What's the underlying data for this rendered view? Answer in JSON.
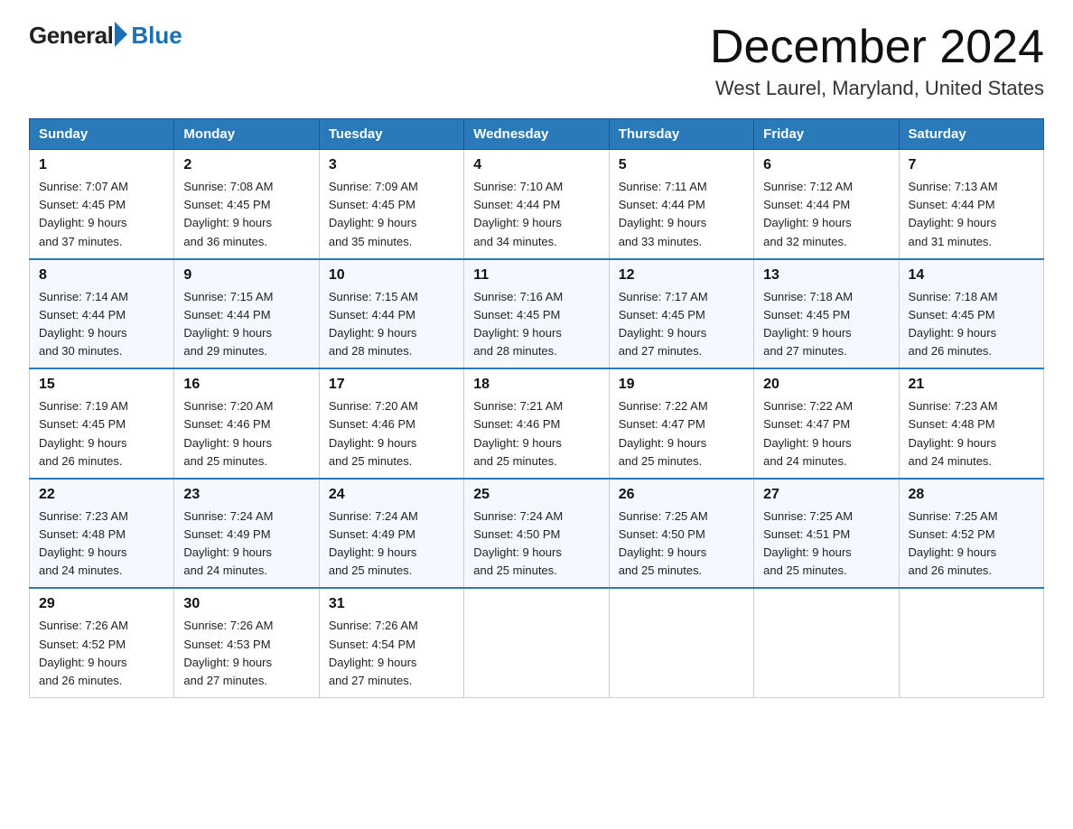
{
  "header": {
    "logo_general": "General",
    "logo_blue": "Blue",
    "month_title": "December 2024",
    "location": "West Laurel, Maryland, United States"
  },
  "days_of_week": [
    "Sunday",
    "Monday",
    "Tuesday",
    "Wednesday",
    "Thursday",
    "Friday",
    "Saturday"
  ],
  "weeks": [
    [
      {
        "day": "1",
        "sunrise": "7:07 AM",
        "sunset": "4:45 PM",
        "daylight": "9 hours and 37 minutes."
      },
      {
        "day": "2",
        "sunrise": "7:08 AM",
        "sunset": "4:45 PM",
        "daylight": "9 hours and 36 minutes."
      },
      {
        "day": "3",
        "sunrise": "7:09 AM",
        "sunset": "4:45 PM",
        "daylight": "9 hours and 35 minutes."
      },
      {
        "day": "4",
        "sunrise": "7:10 AM",
        "sunset": "4:44 PM",
        "daylight": "9 hours and 34 minutes."
      },
      {
        "day": "5",
        "sunrise": "7:11 AM",
        "sunset": "4:44 PM",
        "daylight": "9 hours and 33 minutes."
      },
      {
        "day": "6",
        "sunrise": "7:12 AM",
        "sunset": "4:44 PM",
        "daylight": "9 hours and 32 minutes."
      },
      {
        "day": "7",
        "sunrise": "7:13 AM",
        "sunset": "4:44 PM",
        "daylight": "9 hours and 31 minutes."
      }
    ],
    [
      {
        "day": "8",
        "sunrise": "7:14 AM",
        "sunset": "4:44 PM",
        "daylight": "9 hours and 30 minutes."
      },
      {
        "day": "9",
        "sunrise": "7:15 AM",
        "sunset": "4:44 PM",
        "daylight": "9 hours and 29 minutes."
      },
      {
        "day": "10",
        "sunrise": "7:15 AM",
        "sunset": "4:44 PM",
        "daylight": "9 hours and 28 minutes."
      },
      {
        "day": "11",
        "sunrise": "7:16 AM",
        "sunset": "4:45 PM",
        "daylight": "9 hours and 28 minutes."
      },
      {
        "day": "12",
        "sunrise": "7:17 AM",
        "sunset": "4:45 PM",
        "daylight": "9 hours and 27 minutes."
      },
      {
        "day": "13",
        "sunrise": "7:18 AM",
        "sunset": "4:45 PM",
        "daylight": "9 hours and 27 minutes."
      },
      {
        "day": "14",
        "sunrise": "7:18 AM",
        "sunset": "4:45 PM",
        "daylight": "9 hours and 26 minutes."
      }
    ],
    [
      {
        "day": "15",
        "sunrise": "7:19 AM",
        "sunset": "4:45 PM",
        "daylight": "9 hours and 26 minutes."
      },
      {
        "day": "16",
        "sunrise": "7:20 AM",
        "sunset": "4:46 PM",
        "daylight": "9 hours and 25 minutes."
      },
      {
        "day": "17",
        "sunrise": "7:20 AM",
        "sunset": "4:46 PM",
        "daylight": "9 hours and 25 minutes."
      },
      {
        "day": "18",
        "sunrise": "7:21 AM",
        "sunset": "4:46 PM",
        "daylight": "9 hours and 25 minutes."
      },
      {
        "day": "19",
        "sunrise": "7:22 AM",
        "sunset": "4:47 PM",
        "daylight": "9 hours and 25 minutes."
      },
      {
        "day": "20",
        "sunrise": "7:22 AM",
        "sunset": "4:47 PM",
        "daylight": "9 hours and 24 minutes."
      },
      {
        "day": "21",
        "sunrise": "7:23 AM",
        "sunset": "4:48 PM",
        "daylight": "9 hours and 24 minutes."
      }
    ],
    [
      {
        "day": "22",
        "sunrise": "7:23 AM",
        "sunset": "4:48 PM",
        "daylight": "9 hours and 24 minutes."
      },
      {
        "day": "23",
        "sunrise": "7:24 AM",
        "sunset": "4:49 PM",
        "daylight": "9 hours and 24 minutes."
      },
      {
        "day": "24",
        "sunrise": "7:24 AM",
        "sunset": "4:49 PM",
        "daylight": "9 hours and 25 minutes."
      },
      {
        "day": "25",
        "sunrise": "7:24 AM",
        "sunset": "4:50 PM",
        "daylight": "9 hours and 25 minutes."
      },
      {
        "day": "26",
        "sunrise": "7:25 AM",
        "sunset": "4:50 PM",
        "daylight": "9 hours and 25 minutes."
      },
      {
        "day": "27",
        "sunrise": "7:25 AM",
        "sunset": "4:51 PM",
        "daylight": "9 hours and 25 minutes."
      },
      {
        "day": "28",
        "sunrise": "7:25 AM",
        "sunset": "4:52 PM",
        "daylight": "9 hours and 26 minutes."
      }
    ],
    [
      {
        "day": "29",
        "sunrise": "7:26 AM",
        "sunset": "4:52 PM",
        "daylight": "9 hours and 26 minutes."
      },
      {
        "day": "30",
        "sunrise": "7:26 AM",
        "sunset": "4:53 PM",
        "daylight": "9 hours and 27 minutes."
      },
      {
        "day": "31",
        "sunrise": "7:26 AM",
        "sunset": "4:54 PM",
        "daylight": "9 hours and 27 minutes."
      },
      null,
      null,
      null,
      null
    ]
  ]
}
